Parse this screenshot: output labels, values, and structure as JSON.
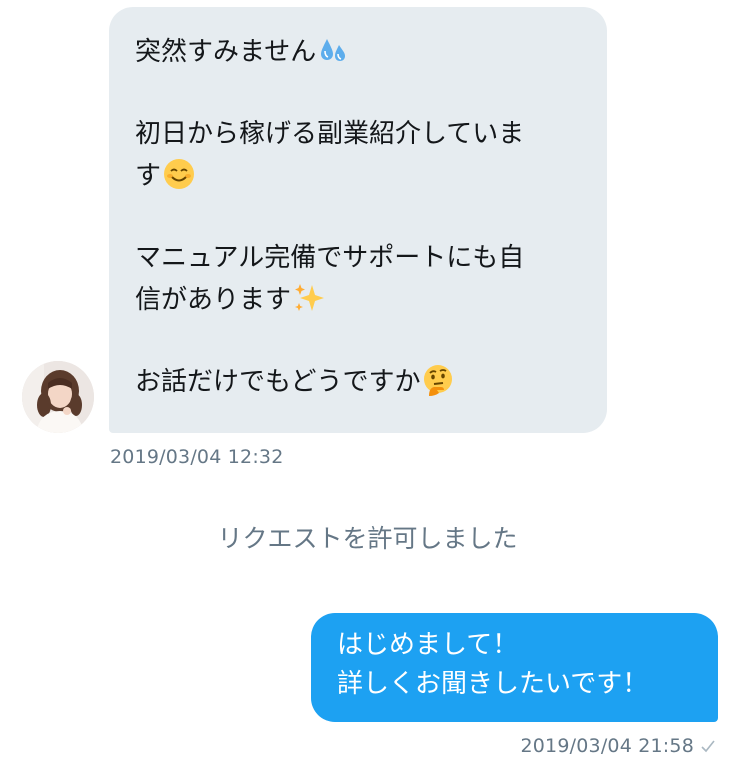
{
  "conversation": {
    "incoming": {
      "paragraphs": [
        {
          "lines": [
            "突然すみません"
          ],
          "emoji": "sweat-droplets"
        },
        {
          "lines": [
            "初日から稼げる副業紹介していま",
            "す"
          ],
          "emoji": "smiling-face"
        },
        {
          "lines": [
            "マニュアル完備でサポートにも自",
            "信があります"
          ],
          "emoji": "sparkles"
        },
        {
          "lines": [
            "お話だけでもどうですか"
          ],
          "emoji": "thinking-face"
        }
      ],
      "timestamp": "2019/03/04 12:32"
    },
    "system_note": "リクエストを許可しました",
    "outgoing": {
      "lines": [
        "はじめまして！",
        "詳しくお聞きしたいです！"
      ],
      "timestamp": "2019/03/04 21:58",
      "status_icon": "check-icon"
    }
  },
  "colors": {
    "incoming_bubble": "#e6ecf0",
    "outgoing_bubble": "#1da1f2",
    "meta_text": "#657786",
    "body_text": "#14171a"
  }
}
